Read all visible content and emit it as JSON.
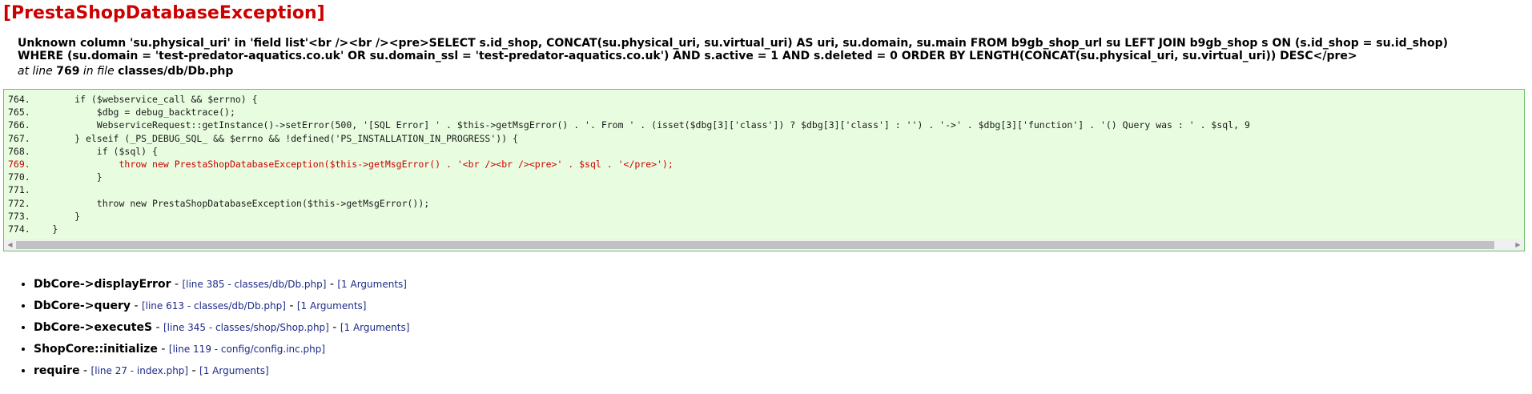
{
  "exception": {
    "title": "[PrestaShopDatabaseException]",
    "message_line1": "Unknown column 'su.physical_uri' in 'field list'<br /><br /><pre>SELECT s.id_shop, CONCAT(su.physical_uri, su.virtual_uri) AS uri, su.domain, su.main FROM b9gb_shop_url su LEFT JOIN b9gb_shop s ON (s.id_shop = su.id_shop)",
    "message_line2": "WHERE (su.domain = 'test-predator-aquatics.co.uk' OR su.domain_ssl = 'test-predator-aquatics.co.uk') AND s.active = 1 AND s.deleted = 0 ORDER BY LENGTH(CONCAT(su.physical_uri, su.virtual_uri)) DESC</pre>",
    "location": {
      "prefix": "at line ",
      "line": "769",
      "middle": " in file ",
      "file": "classes/db/Db.php"
    }
  },
  "code": {
    "highlight_line": "769.",
    "lines": [
      {
        "no": "764.",
        "text": "        if ($webservice_call && $errno) {"
      },
      {
        "no": "765.",
        "text": "            $dbg = debug_backtrace();"
      },
      {
        "no": "766.",
        "text": "            WebserviceRequest::getInstance()->setError(500, '[SQL Error] ' . $this->getMsgError() . '. From ' . (isset($dbg[3]['class']) ? $dbg[3]['class'] : '') . '->' . $dbg[3]['function'] . '() Query was : ' . $sql, 9"
      },
      {
        "no": "767.",
        "text": "        } elseif (_PS_DEBUG_SQL_ && $errno && !defined('PS_INSTALLATION_IN_PROGRESS')) {"
      },
      {
        "no": "768.",
        "text": "            if ($sql) {"
      },
      {
        "no": "769.",
        "text": "                throw new PrestaShopDatabaseException($this->getMsgError() . '<br /><br /><pre>' . $sql . '</pre>');"
      },
      {
        "no": "770.",
        "text": "            }"
      },
      {
        "no": "771.",
        "text": ""
      },
      {
        "no": "772.",
        "text": "            throw new PrestaShopDatabaseException($this->getMsgError());"
      },
      {
        "no": "773.",
        "text": "        }"
      },
      {
        "no": "774.",
        "text": "    }"
      }
    ]
  },
  "scrollbar": {
    "left_arrow": "◀",
    "right_arrow": "▶",
    "position_fraction": 0
  },
  "stack_trace": [
    {
      "function": "DbCore->displayError",
      "separator1": " - ",
      "location": "[line 385 - classes/db/Db.php]",
      "separator2": " - ",
      "arguments": "[1 Arguments]"
    },
    {
      "function": "DbCore->query",
      "separator1": " - ",
      "location": "[line 613 - classes/db/Db.php]",
      "separator2": " - ",
      "arguments": "[1 Arguments]"
    },
    {
      "function": "DbCore->executeS",
      "separator1": " - ",
      "location": "[line 345 - classes/shop/Shop.php]",
      "separator2": " - ",
      "arguments": "[1 Arguments]"
    },
    {
      "function": "ShopCore::initialize",
      "separator1": " - ",
      "location": "[line 119 - config/config.inc.php]",
      "separator2": "",
      "arguments": ""
    },
    {
      "function": "require",
      "separator1": " - ",
      "location": "[line 27 - index.php]",
      "separator2": " - ",
      "arguments": "[1 Arguments]"
    }
  ],
  "colors": {
    "title": "#cc0000",
    "highlight": "#cc0000",
    "code_background": "#e8fde0",
    "code_border": "#67c266",
    "link": "#1c2a88"
  }
}
